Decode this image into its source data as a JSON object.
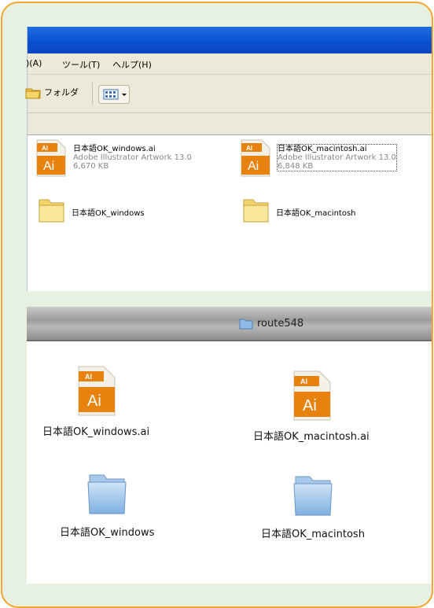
{
  "windows": {
    "menu": {
      "edit_fragment": ")(A)",
      "tools": "ツール(T)",
      "help": "ヘルプ(H)"
    },
    "toolbar": {
      "folders_label": "フォルダ"
    },
    "items": [
      {
        "name": "日本語OK_windows.ai",
        "type": "Adobe Illustrator Artwork 13.0",
        "size": "6,670 KB"
      },
      {
        "name": "日本語OK_macintosh.ai",
        "type": "Adobe Illustrator Artwork 13.0",
        "size": "6,848 KB"
      },
      {
        "name": "日本語OK_windows"
      },
      {
        "name": "日本語OK_macintosh"
      }
    ]
  },
  "mac": {
    "window_title": "route548",
    "items": [
      {
        "name": "日本語OK_windows.ai"
      },
      {
        "name": "日本語OK_macintosh.ai"
      },
      {
        "name": "日本語OK_windows"
      },
      {
        "name": "日本語OK_macintosh"
      }
    ]
  },
  "icons": {
    "ai_badge_top": "AI",
    "ai_badge_main": "Ai"
  },
  "colors": {
    "frame_border": "#f3a72c",
    "frame_bg": "#e6f1e2",
    "xp_titlebar": "#0a4fd0",
    "ai_orange": "#e8820f"
  }
}
